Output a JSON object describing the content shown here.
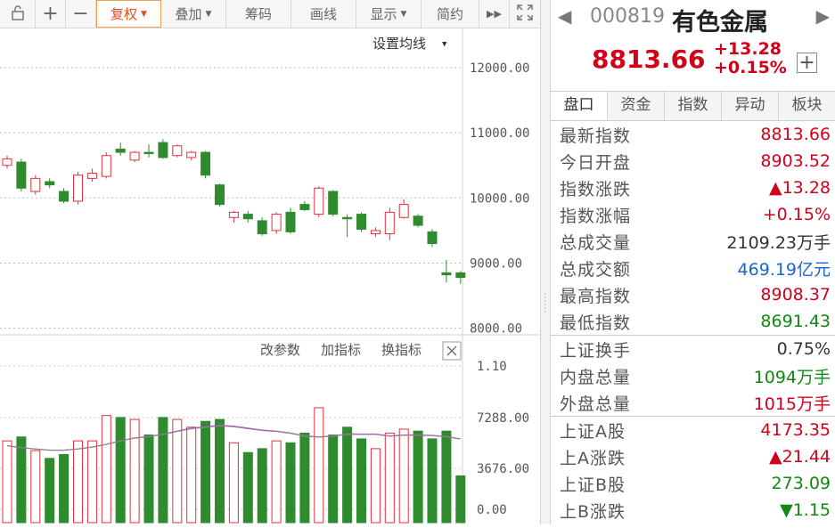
{
  "toolbar": {
    "buttons": [
      {
        "label": "",
        "icon": "lock-icon"
      },
      {
        "label": "+",
        "icon": "zoom-in-icon"
      },
      {
        "label": "−",
        "icon": "zoom-out-icon"
      },
      {
        "label": "复权",
        "dropdown": true,
        "active": true
      },
      {
        "label": "叠加",
        "dropdown": true
      },
      {
        "label": "筹码"
      },
      {
        "label": "画线"
      },
      {
        "label": "显示",
        "dropdown": true
      },
      {
        "label": "简约"
      },
      {
        "label": "▶▶",
        "icon": "fast-forward-icon"
      },
      {
        "label": "",
        "icon": "fullscreen-icon"
      }
    ]
  },
  "chart": {
    "ma_settings": "设置均线",
    "price_axis": [
      "12000.00",
      "11000.00",
      "10000.00",
      "9000.00",
      "8000.00"
    ],
    "indicator_buttons": [
      "改参数",
      "加指标",
      "换指标"
    ],
    "volume_axis": [
      "1.10",
      "7288.00",
      "3676.00",
      "0.00"
    ],
    "up_color": "#e0303a",
    "down_color": "#2e8b2e"
  },
  "chart_data": {
    "type": "candlestick",
    "price_ylim": [
      7900,
      12600
    ],
    "candles": [
      {
        "o": 10500,
        "c": 10600,
        "h": 10650,
        "l": 10450
      },
      {
        "o": 10550,
        "c": 10150,
        "h": 10600,
        "l": 10100
      },
      {
        "o": 10100,
        "c": 10300,
        "h": 10350,
        "l": 10050
      },
      {
        "o": 10250,
        "c": 10200,
        "h": 10300,
        "l": 10150
      },
      {
        "o": 10100,
        "c": 9950,
        "h": 10150,
        "l": 9920
      },
      {
        "o": 9950,
        "c": 10350,
        "h": 10400,
        "l": 9900
      },
      {
        "o": 10300,
        "c": 10380,
        "h": 10450,
        "l": 10250
      },
      {
        "o": 10330,
        "c": 10650,
        "h": 10700,
        "l": 10300
      },
      {
        "o": 10750,
        "c": 10700,
        "h": 10850,
        "l": 10650
      },
      {
        "o": 10580,
        "c": 10700,
        "h": 10720,
        "l": 10550
      },
      {
        "o": 10700,
        "c": 10680,
        "h": 10820,
        "l": 10620
      },
      {
        "o": 10850,
        "c": 10620,
        "h": 10900,
        "l": 10600
      },
      {
        "o": 10650,
        "c": 10800,
        "h": 10820,
        "l": 10620
      },
      {
        "o": 10620,
        "c": 10700,
        "h": 10720,
        "l": 10580
      },
      {
        "o": 10700,
        "c": 10350,
        "h": 10720,
        "l": 10300
      },
      {
        "o": 10200,
        "c": 9900,
        "h": 10220,
        "l": 9870
      },
      {
        "o": 9700,
        "c": 9780,
        "h": 9800,
        "l": 9620
      },
      {
        "o": 9750,
        "c": 9680,
        "h": 9800,
        "l": 9620
      },
      {
        "o": 9650,
        "c": 9450,
        "h": 9700,
        "l": 9420
      },
      {
        "o": 9500,
        "c": 9750,
        "h": 9780,
        "l": 9450
      },
      {
        "o": 9780,
        "c": 9480,
        "h": 9850,
        "l": 9450
      },
      {
        "o": 9900,
        "c": 9820,
        "h": 9950,
        "l": 9800
      },
      {
        "o": 9750,
        "c": 10150,
        "h": 10180,
        "l": 9700
      },
      {
        "o": 10100,
        "c": 9750,
        "h": 10120,
        "l": 9720
      },
      {
        "o": 9700,
        "c": 9680,
        "h": 9750,
        "l": 9400
      },
      {
        "o": 9750,
        "c": 9520,
        "h": 9780,
        "l": 9480
      },
      {
        "o": 9450,
        "c": 9500,
        "h": 9550,
        "l": 9400
      },
      {
        "o": 9450,
        "c": 9780,
        "h": 9850,
        "l": 9350
      },
      {
        "o": 9700,
        "c": 9900,
        "h": 9980,
        "l": 9680
      },
      {
        "o": 9720,
        "c": 9580,
        "h": 9750,
        "l": 9550
      },
      {
        "o": 9480,
        "c": 9300,
        "h": 9520,
        "l": 9250
      },
      {
        "o": 8850,
        "c": 8820,
        "h": 9050,
        "l": 8700
      },
      {
        "o": 8850,
        "c": 8780,
        "h": 8880,
        "l": 8680
      }
    ],
    "volume_ylim": [
      0,
      8000
    ],
    "volumes": [
      4200,
      4400,
      3700,
      3300,
      3500,
      4200,
      4200,
      5500,
      5400,
      5300,
      4500,
      5400,
      5300,
      4900,
      5200,
      5300,
      4100,
      3600,
      3800,
      4200,
      4100,
      4600,
      5900,
      4500,
      4900,
      4300,
      3800,
      4600,
      4800,
      4700,
      4300,
      4700,
      2400
    ],
    "ma_line": [
      3950,
      3850,
      3780,
      3720,
      3720,
      3780,
      3880,
      4020,
      4200,
      4350,
      4420,
      4550,
      4700,
      4850,
      4920,
      5000,
      4950,
      4850,
      4750,
      4700,
      4600,
      4450,
      4400,
      4450,
      4550,
      4550,
      4550,
      4450,
      4500,
      4500,
      4480,
      4420,
      4300
    ]
  },
  "quote": {
    "code": "000819",
    "name": "有色金属",
    "price": "8813.66",
    "change": "+13.28",
    "change_pct": "+0.15%"
  },
  "tabs": [
    "盘口",
    "资金",
    "指数",
    "异动",
    "板块"
  ],
  "stats": [
    {
      "label": "最新指数",
      "value": "8813.66",
      "color": "red"
    },
    {
      "label": "今日开盘",
      "value": "8903.52",
      "color": "red"
    },
    {
      "label": "指数涨跌",
      "value": "▲13.28",
      "color": "red"
    },
    {
      "label": "指数涨幅",
      "value": "+0.15%",
      "color": "red"
    },
    {
      "label": "总成交量",
      "value": "2109.23万手",
      "color": "dark"
    },
    {
      "label": "总成交额",
      "value": "469.19亿元",
      "color": "blue"
    },
    {
      "label": "最高指数",
      "value": "8908.37",
      "color": "red"
    },
    {
      "label": "最低指数",
      "value": "8691.43",
      "color": "green"
    },
    {
      "label": "上证换手",
      "value": "0.75%",
      "color": "dark",
      "sep": true
    },
    {
      "label": "内盘总量",
      "value": "1094万手",
      "color": "green"
    },
    {
      "label": "外盘总量",
      "value": "1015万手",
      "color": "red"
    },
    {
      "label": "上证A股",
      "value": "4173.35",
      "color": "red",
      "sep": true
    },
    {
      "label": "上A涨跌",
      "value": "▲21.44",
      "color": "red"
    },
    {
      "label": "上证B股",
      "value": "273.09",
      "color": "green"
    },
    {
      "label": "上B涨跌",
      "value": "▼1.15",
      "color": "green"
    }
  ]
}
